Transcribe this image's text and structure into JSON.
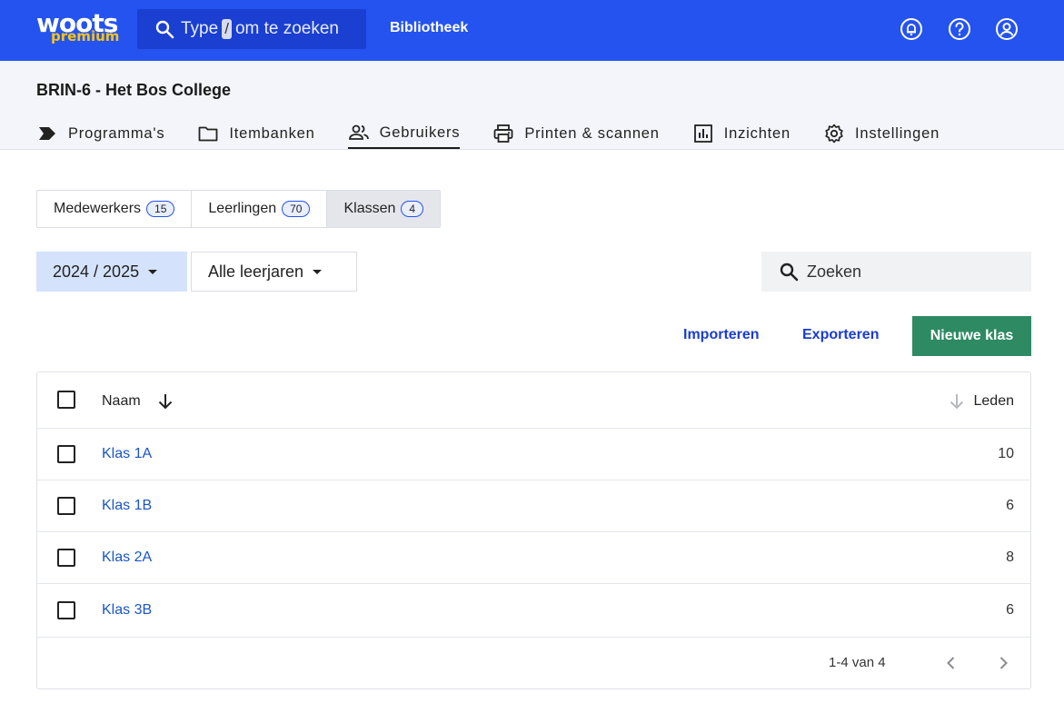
{
  "topbar": {
    "logo_main": "woots",
    "logo_sub": "premium",
    "search_prefix": "Type",
    "search_key": "/",
    "search_suffix": "om te zoeken",
    "library_label": "Bibliotheek",
    "icons": [
      "notifications-icon",
      "help-icon",
      "account-icon"
    ]
  },
  "org": {
    "title": "BRIN-6 - Het Bos College"
  },
  "nav_tabs": [
    {
      "label": "Programma's",
      "icon": "program-icon"
    },
    {
      "label": "Itembanken",
      "icon": "folder-icon"
    },
    {
      "label": "Gebruikers",
      "icon": "users-icon"
    },
    {
      "label": "Printen & scannen",
      "icon": "printer-icon"
    },
    {
      "label": "Inzichten",
      "icon": "chart-icon"
    },
    {
      "label": "Instellingen",
      "icon": "gear-icon"
    }
  ],
  "segments": [
    {
      "label": "Medewerkers",
      "count": "15"
    },
    {
      "label": "Leerlingen",
      "count": "70"
    },
    {
      "label": "Klassen",
      "count": "4"
    }
  ],
  "filters": {
    "year": "2024 / 2025",
    "level": "Alle leerjaren",
    "search_placeholder": "Zoeken"
  },
  "actions": {
    "import": "Importeren",
    "export": "Exporteren",
    "new_class": "Nieuwe klas"
  },
  "table": {
    "col_name": "Naam",
    "col_members": "Leden",
    "rows": [
      {
        "name": "Klas 1A",
        "members": "10"
      },
      {
        "name": "Klas 1B",
        "members": "6"
      },
      {
        "name": "Klas 2A",
        "members": "8"
      },
      {
        "name": "Klas 3B",
        "members": "6"
      }
    ],
    "pagination": "1-4 van 4"
  },
  "colors": {
    "brand": "#2553f0",
    "primary_button": "#2e8a63",
    "link": "#1a55c4"
  }
}
